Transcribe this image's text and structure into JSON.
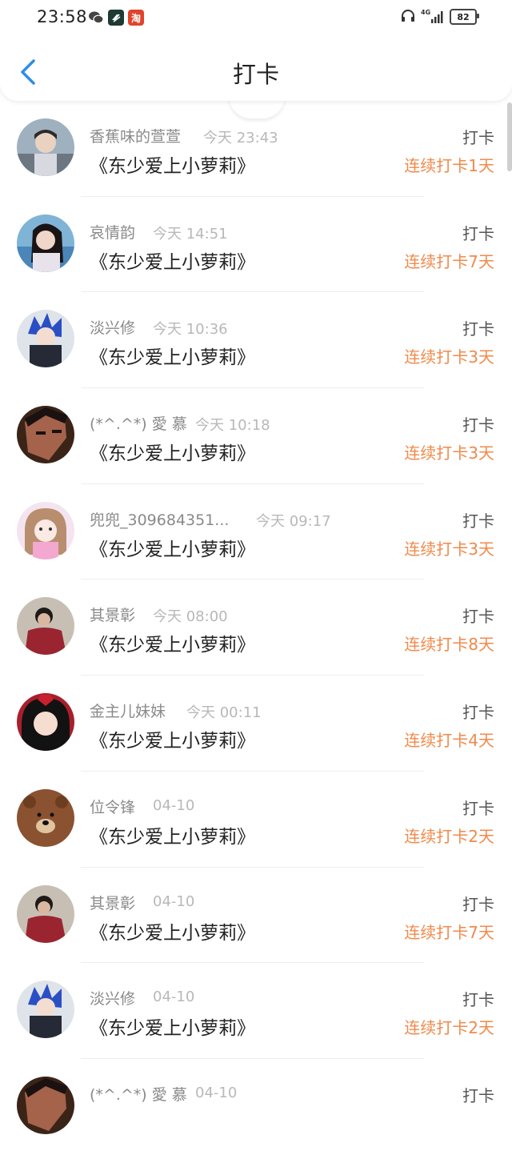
{
  "status_bar": {
    "time": "23:58",
    "notification_icons": [
      "wechat-icon",
      "app-icon",
      "taobao-icon"
    ],
    "taobao_glyph": "淘",
    "network": "4G",
    "battery": "82"
  },
  "header": {
    "title": "打卡"
  },
  "accent_color": "#f08a4b",
  "items": [
    {
      "name": "香蕉味的萱萱",
      "time": "今天 23:43",
      "book": "《东少爱上小萝莉》",
      "label": "打卡",
      "streak": "连续打卡1天"
    },
    {
      "name": "哀情韵",
      "time": "今天 14:51",
      "book": "《东少爱上小萝莉》",
      "label": "打卡",
      "streak": "连续打卡7天"
    },
    {
      "name": "淡兴修",
      "time": "今天 10:36",
      "book": "《东少爱上小萝莉》",
      "label": "打卡",
      "streak": "连续打卡3天"
    },
    {
      "name": "(*^.^*) 愛 慕",
      "time": "今天 10:18",
      "book": "《东少爱上小萝莉》",
      "label": "打卡",
      "streak": "连续打卡3天"
    },
    {
      "name": "兜兜_309684351...",
      "time": "今天 09:17",
      "book": "《东少爱上小萝莉》",
      "label": "打卡",
      "streak": "连续打卡3天"
    },
    {
      "name": "其景彰",
      "time": "今天 08:00",
      "book": "《东少爱上小萝莉》",
      "label": "打卡",
      "streak": "连续打卡8天"
    },
    {
      "name": "金主儿妹妹",
      "time": "今天 00:11",
      "book": "《东少爱上小萝莉》",
      "label": "打卡",
      "streak": "连续打卡4天"
    },
    {
      "name": "位令锋",
      "time": "04-10",
      "book": "《东少爱上小萝莉》",
      "label": "打卡",
      "streak": "连续打卡2天"
    },
    {
      "name": "其景彰",
      "time": "04-10",
      "book": "《东少爱上小萝莉》",
      "label": "打卡",
      "streak": "连续打卡7天"
    },
    {
      "name": "淡兴修",
      "time": "04-10",
      "book": "《东少爱上小萝莉》",
      "label": "打卡",
      "streak": "连续打卡2天"
    },
    {
      "name": "(*^.^*) 愛 慕",
      "time": "04-10",
      "book": "",
      "label": "打卡",
      "streak": ""
    }
  ]
}
